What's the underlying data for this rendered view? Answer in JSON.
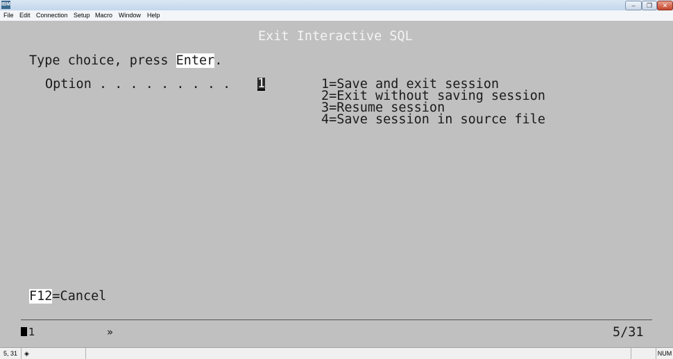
{
  "window": {
    "app_icon": "IBM",
    "controls": [
      "minimize-icon",
      "restore-icon",
      "close-icon"
    ]
  },
  "menu": [
    "File",
    "Edit",
    "Connection",
    "Setup",
    "Macro",
    "Window",
    "Help"
  ],
  "screen": {
    "title": "Exit Interactive SQL",
    "instruction_prefix": "Type choice, press ",
    "instruction_key": "Enter",
    "instruction_suffix": ".",
    "option_label": "Option . . . . . . . . .",
    "option_value": "1",
    "choices": [
      "1=Save and exit session",
      "2=Exit without saving session",
      "3=Resume session",
      "4=Save session in source file"
    ],
    "fkey": "F12",
    "fkey_label": "=Cancel"
  },
  "oia": {
    "session": "1",
    "indicator": "»",
    "cursor_pos": "5/31"
  },
  "statusbar": {
    "position": "5, 31",
    "num": "NUM"
  }
}
